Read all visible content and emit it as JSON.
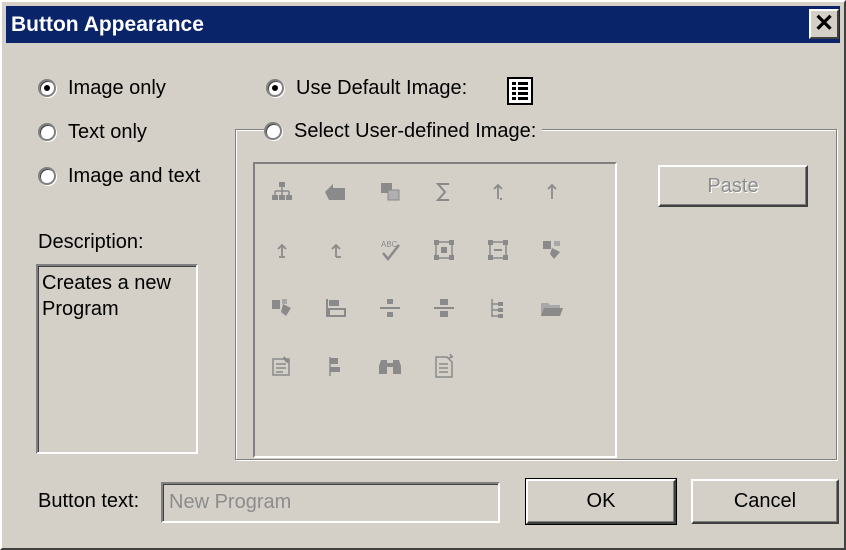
{
  "window": {
    "title": "Button Appearance",
    "close_glyph": "✕"
  },
  "display_options": [
    {
      "label": "Image only",
      "checked": true
    },
    {
      "label": "Text only",
      "checked": false
    },
    {
      "label": "Image and text",
      "checked": false
    }
  ],
  "image_source": {
    "use_default_label": "Use Default Image:",
    "use_default_checked": true,
    "user_defined_label": "Select User-defined Image:",
    "user_defined_checked": false
  },
  "description": {
    "label": "Description:",
    "text": "Creates a new Program"
  },
  "icons": [
    "hierarchy-icon",
    "arrow-icon",
    "copy-layers-icon",
    "sum-icon",
    "up-arrow-small-icon",
    "up-arrow-icon",
    "up-arrow-step-icon",
    "up-arrow-step2-icon",
    "spell-check-icon",
    "select-frame-icon",
    "select-frame2-icon",
    "shapes-icon",
    "shapes2-icon",
    "align-icon",
    "distribute-vertical-icon",
    "distribute-vertical2-icon",
    "tree-icon",
    "open-folder-icon",
    "properties-icon",
    "flags-icon",
    "binoculars-icon",
    "new-document-icon"
  ],
  "buttons": {
    "paste": "Paste",
    "ok": "OK",
    "cancel": "Cancel"
  },
  "button_text": {
    "label": "Button text:",
    "value": "New Program"
  },
  "colors": {
    "titlebar": "#0a246a",
    "face": "#d4d0c8",
    "disabled_text": "#8c8c8c"
  }
}
